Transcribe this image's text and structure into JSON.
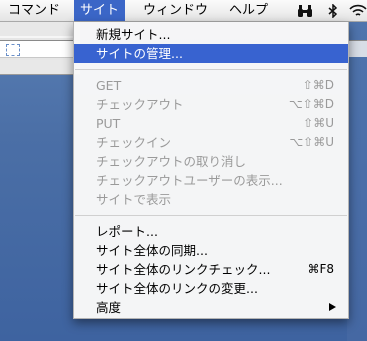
{
  "menubar": {
    "items": [
      {
        "label": "コマンド"
      },
      {
        "label": "サイト"
      },
      {
        "label": "ウィンドウ"
      },
      {
        "label": "ヘルプ"
      }
    ]
  },
  "site_menu": {
    "groups": [
      [
        {
          "label": "新規サイト...",
          "shortcut": "",
          "enabled": true
        },
        {
          "label": "サイトの管理...",
          "shortcut": "",
          "enabled": true,
          "highlighted": true
        }
      ],
      [
        {
          "label": "GET",
          "shortcut": "⇧⌘D",
          "enabled": false
        },
        {
          "label": "チェックアウト",
          "shortcut": "⌥⇧⌘D",
          "enabled": false
        },
        {
          "label": "PUT",
          "shortcut": "⇧⌘U",
          "enabled": false
        },
        {
          "label": "チェックイン",
          "shortcut": "⌥⇧⌘U",
          "enabled": false
        },
        {
          "label": "チェックアウトの取り消し",
          "shortcut": "",
          "enabled": false
        },
        {
          "label": "チェックアウトユーザーの表示...",
          "shortcut": "",
          "enabled": false
        },
        {
          "label": "サイトで表示",
          "shortcut": "",
          "enabled": false
        }
      ],
      [
        {
          "label": "レポート...",
          "shortcut": "",
          "enabled": true
        },
        {
          "label": "サイト全体の同期...",
          "shortcut": "",
          "enabled": true
        },
        {
          "label": "サイト全体のリンクチェック...",
          "shortcut": "⌘F8",
          "enabled": true
        },
        {
          "label": "サイト全体のリンクの変更...",
          "shortcut": "",
          "enabled": true
        },
        {
          "label": "高度",
          "shortcut": "",
          "enabled": true,
          "submenu": true
        }
      ]
    ]
  },
  "status_icons": [
    "binoculars-icon",
    "bluetooth-icon",
    "wifi-icon"
  ],
  "colors": {
    "highlight": "#3863d0",
    "menubar_active": "#3b66c7",
    "disabled_text": "#9a9a9a",
    "desktop": "#4b6fa6"
  }
}
